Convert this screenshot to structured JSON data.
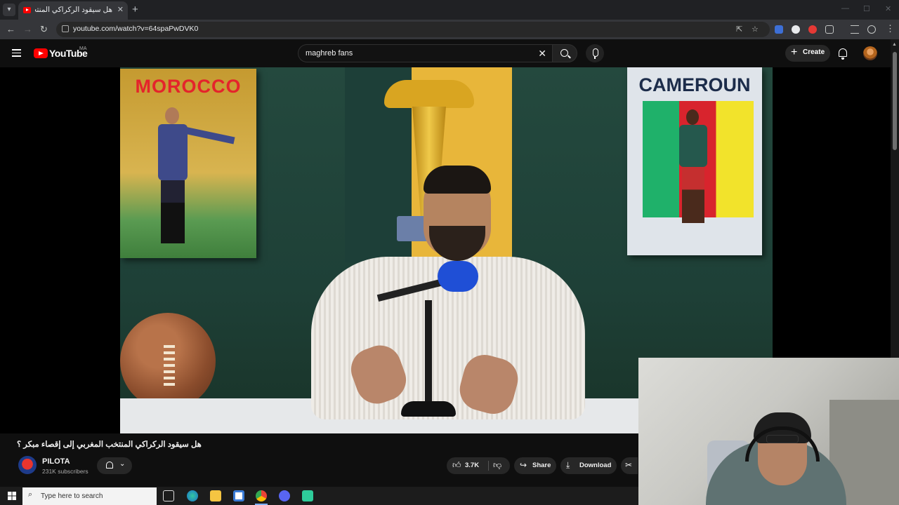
{
  "browser": {
    "tab": {
      "title": "هل سيقود الركراكي المنتخب",
      "favicon": "youtube-icon",
      "audio_icon": "speaker-icon"
    },
    "new_tab_icon": "plus-icon",
    "url": "youtube.com/watch?v=64spaPwDVK0",
    "toolbar_icons": [
      "back-icon",
      "forward-icon",
      "reload-icon",
      "site-info-icon",
      "install-icon",
      "bookmark-star-icon",
      "extension-icon",
      "puzzle-icon",
      "media-icon",
      "profile-icon",
      "menu-dots-icon"
    ]
  },
  "youtube": {
    "logo_text": "YouTube",
    "country_code": "MA",
    "search": {
      "value": "maghreb fans"
    },
    "create_label": "Create",
    "colors": {
      "brand_red": "#ff0000",
      "background": "#0f0f0f",
      "pill_bg": "#272727"
    }
  },
  "poster_left": {
    "title": "MOROCCO"
  },
  "poster_right": {
    "title": "CAMEROUN"
  },
  "video": {
    "title": "هل سيقود الركراكي المنتخب المغربي إلى إقصاء مبكر ؟",
    "channel": {
      "name": "PILOTA",
      "subscribers": "231K subscribers"
    },
    "actions": {
      "likes": "3.7K",
      "share": "Share",
      "download": "Download"
    }
  },
  "taskbar": {
    "search_placeholder": "Type here to search",
    "apps": [
      "task-view-icon",
      "edge-icon",
      "file-explorer-icon",
      "store-icon",
      "chrome-icon",
      "discord-icon",
      "app-icon"
    ]
  }
}
